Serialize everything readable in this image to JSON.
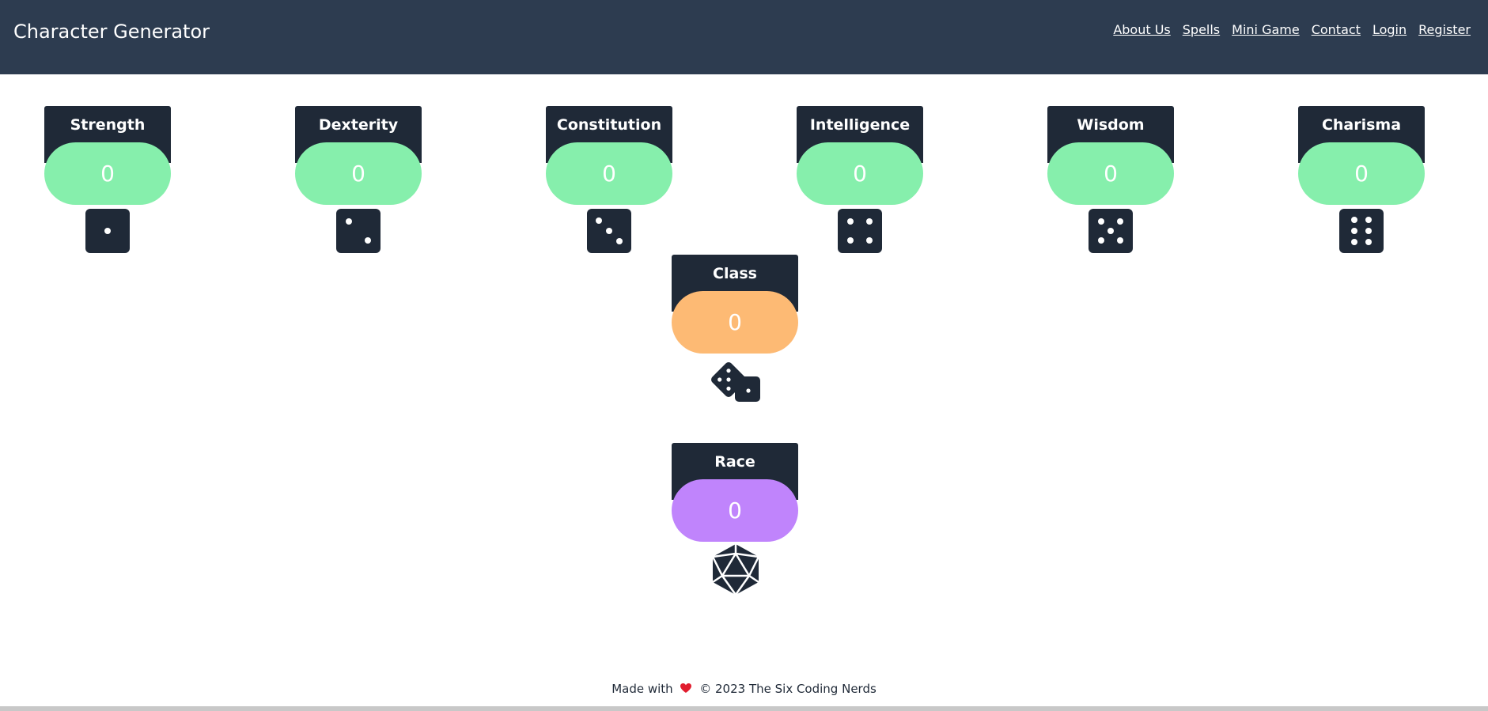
{
  "navbar": {
    "brand": "Character Generator",
    "links": [
      "About Us",
      "Spells",
      "Mini Game",
      "Contact",
      "Login",
      "Register"
    ]
  },
  "stats": [
    {
      "title": "Strength",
      "value": "0",
      "die_icon": "die-face-1-icon"
    },
    {
      "title": "Dexterity",
      "value": "0",
      "die_icon": "die-face-2-icon"
    },
    {
      "title": "Constitution",
      "value": "0",
      "die_icon": "die-face-3-icon"
    },
    {
      "title": "Intelligence",
      "value": "0",
      "die_icon": "die-face-4-icon"
    },
    {
      "title": "Wisdom",
      "value": "0",
      "die_icon": "die-face-5-icon"
    },
    {
      "title": "Charisma",
      "value": "0",
      "die_icon": "die-face-6-icon"
    }
  ],
  "class_card": {
    "title": "Class",
    "value": "0",
    "icon": "dice-pair-icon"
  },
  "race_card": {
    "title": "Race",
    "value": "0",
    "icon": "d20-icon"
  },
  "footer": {
    "prefix": "Made with",
    "heart_icon": "heart-icon",
    "suffix": "© 2023 The Six Coding Nerds"
  },
  "colors": {
    "navbar": "#2d3c50",
    "card_dark": "#1f2937",
    "stat_green": "#86efac",
    "class_orange": "#fdba74",
    "race_purple": "#c084fc"
  }
}
